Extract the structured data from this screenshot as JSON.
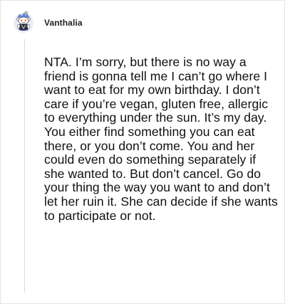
{
  "comment": {
    "username": "Vanthalia",
    "avatar_icon": "reddit-snoo-avatar-icon",
    "body": "NTA. I’m sorry, but there is no way a friend is gonna tell me I can’t go where I want to eat for my own birthday. I don’t care if you’re vegan, gluten free, allergic to everything under the sun. It’s my day. You either find something you can eat there, or you don’t come. You and her could even do something separately if she wanted to. But don’t cancel. Go do your thing the way you want to and don’t let her ruin it. She can decide if she wants to participate or not."
  },
  "colors": {
    "border": "#e4e4e4",
    "thread_line": "#d8d8d8",
    "text": "#111111",
    "avatar_bg": "#dbe3f7",
    "avatar_accent": "#7193ff"
  }
}
